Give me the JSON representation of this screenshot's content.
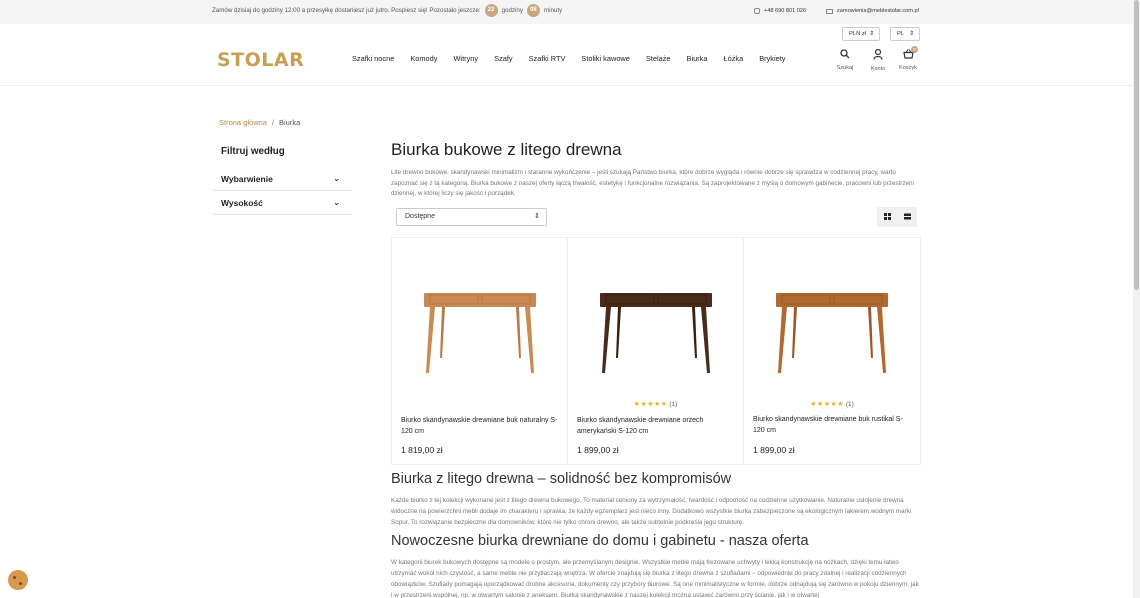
{
  "topbar": {
    "promo_prefix": "Zamów dzisiaj do godziny 12:00 a przesyłkę dostaniesz już jutro. Pospiesz się! Pozostało jeszcze:",
    "hours_value": "22",
    "hours_label": "godziny",
    "minutes_value": "08",
    "minutes_label": "minuty",
    "phone": "+48 690 801 026",
    "email": "zamowienia@meblestolar.com.pl"
  },
  "header": {
    "logo": "STOLAR",
    "nav": [
      "Szafki nocne",
      "Komody",
      "Witryny",
      "Szafy",
      "Szafki RTV",
      "Stoliki kawowe",
      "Stelaże",
      "Biurka",
      "Łóżka",
      "Brykiety"
    ],
    "currency": "PLN zł",
    "language": "PL",
    "search_label": "Szukaj",
    "account_label": "Konto",
    "cart_label": "Koszyk",
    "cart_count": "0"
  },
  "breadcrumb": {
    "home": "Strona główna",
    "separator": "/",
    "current": "Biurka"
  },
  "sidebar": {
    "title": "Filtruj według",
    "filters": [
      "Wybarwienie",
      "Wysokość"
    ]
  },
  "main": {
    "title": "Biurka bukowe z litego drewna",
    "description": "Lite drewno bukowe, skandynawski minimalizm i staranne wykończenie – jeśli szukają Państwo biurka, które dobrze wygląda i równie dobrze się sprawdza w codziennej pracy, warto zapoznać się z tą kategorią. Biurka bukowe z naszej oferty łączą trwałość, estetykę i funkcjonalne rozwiązania. Są zaprojektowane z myślą o domowym gabinecie, pracowni lub przestrzeni dziennej, w której liczy się jakość i porządek.",
    "sort_value": "Dostępne"
  },
  "products": [
    {
      "name": "Biurko skandynawskie drewniane buk naturalny S-120 cm",
      "price": "1 819,00 zł",
      "rating_count": "",
      "color": "#c98a55"
    },
    {
      "name": "Biurko skandynawskie drewniane orzech amerykański S-120 cm",
      "price": "1 899,00 zł",
      "rating_count": "(1)",
      "color": "#4a2a1a"
    },
    {
      "name": "Biurko skandynawskie drewniane buk rustikal S-120 cm",
      "price": "1 899,00 zł",
      "rating_count": "(1)",
      "color": "#b06a30"
    }
  ],
  "sections": [
    {
      "heading": "Biurka z litego drewna – solidność bez kompromisów",
      "text": "Każde biurko z tej kolekcji wykonane jest z litego drewna bukowego. To materiał ceniony za wytrzymałość, twardość i odporność na codzienne użytkowanie. Naturalne usłojenie drewna widoczne na powierzchni mebli dodaje im charakteru i sprawia, że każdy egzemplarz jest nieco inny. Dodatkowo wszystkie biurka zabezpieczone są ekologicznym lakierem wodnym marki Sopur. To rozwiązanie bezpieczne dla domowników, które nie tylko chroni drewno, ale także subtelnie podkreśla jego strukturę."
    },
    {
      "heading": "Nowoczesne biurka drewniane do domu i gabinetu - nasza oferta",
      "text": "W kategorii biurek bukowych dostępne są modele o prostym, ale przemyślanym designie. Wszystkie meble mają frezowane uchwyty i lekką konstrukcję na nóżkach, dzięki temu łatwo utrzymać wokół nich czystość, a same meble nie przytłaczają wnętrza. W ofercie znajdują się biurka z litego drewna z szufladami – odpowiednie do pracy zdalnej i realizacji codziennych obowiązków. Szuflady pomagają uporządkować drobne akcesoria, dokumenty czy przybory biurowe. Są one minimalistyczne w formie, dobrze odnajdują się zarówno w pokoju dziennym, jak i w przestrzeni wspólnej, np. w otwartym salonie z aneksem. Biurka skandynawskie z naszej kolekcji można ustawić zarówno przy ścianie, jak i w otwartej"
    }
  ]
}
